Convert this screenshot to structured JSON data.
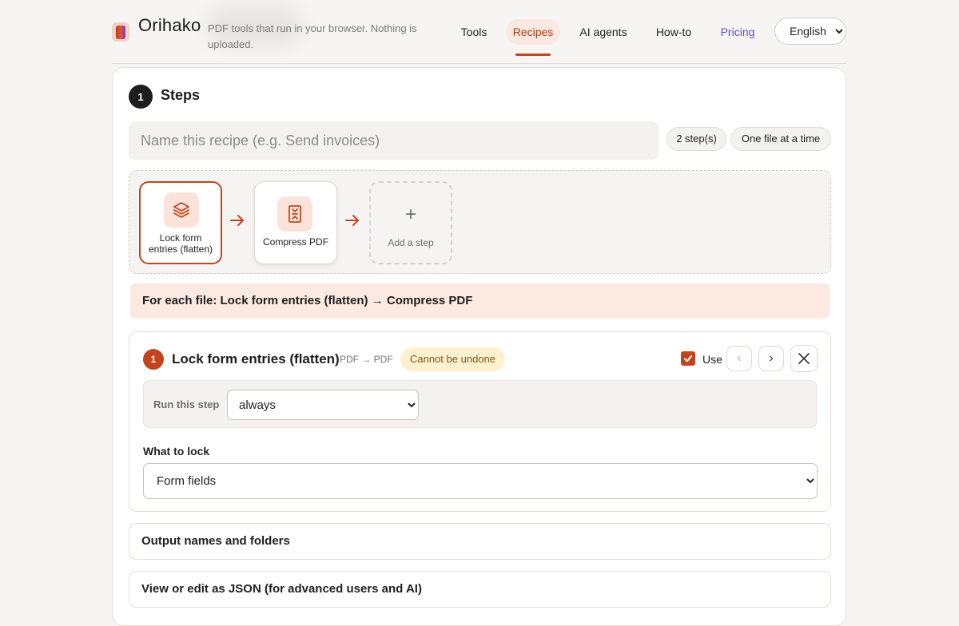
{
  "header": {
    "brand": "Orihako",
    "tagline": "PDF tools that run in your browser. Nothing is uploaded.",
    "nav": {
      "tools": "Tools",
      "recipes": "Recipes",
      "ai_agents": "AI agents",
      "howto": "How-to",
      "pricing": "Pricing"
    },
    "language": "English",
    "active_tab": "Recipes",
    "colors": {
      "accent": "#c2451e",
      "pricing": "#6a48c4"
    }
  },
  "steps_section": {
    "number": "1",
    "title": "Steps",
    "recipe_name_placeholder": "Name this recipe (e.g. Send invoices)",
    "recipe_name_value": "",
    "step_count_badge": "2 step(s)",
    "mode_badge": "One file at a time"
  },
  "pipeline": {
    "steps": [
      {
        "label": "Lock form entries (flatten)",
        "icon": "layers-icon",
        "selected": true
      },
      {
        "label": "Compress PDF",
        "icon": "compress-icon",
        "selected": false
      }
    ],
    "add_label": "Add a step",
    "add_icon": "+"
  },
  "summary": "For each file: Lock form entries (flatten) → Compress PDF",
  "step_detail": {
    "number": "1",
    "title": "Lock form entries (flatten)",
    "io": "PDF → PDF",
    "badge": "Cannot be undone",
    "use_label": "Use",
    "use_checked": true,
    "prev_glyph": "‹",
    "next_glyph": "›",
    "run_label": "Run this step",
    "run_value": "always",
    "lock_label": "What to lock",
    "lock_value": "Form fields"
  },
  "collapsibles": {
    "output": "Output names and folders",
    "json": "View or edit as JSON (for advanced users and AI)"
  }
}
